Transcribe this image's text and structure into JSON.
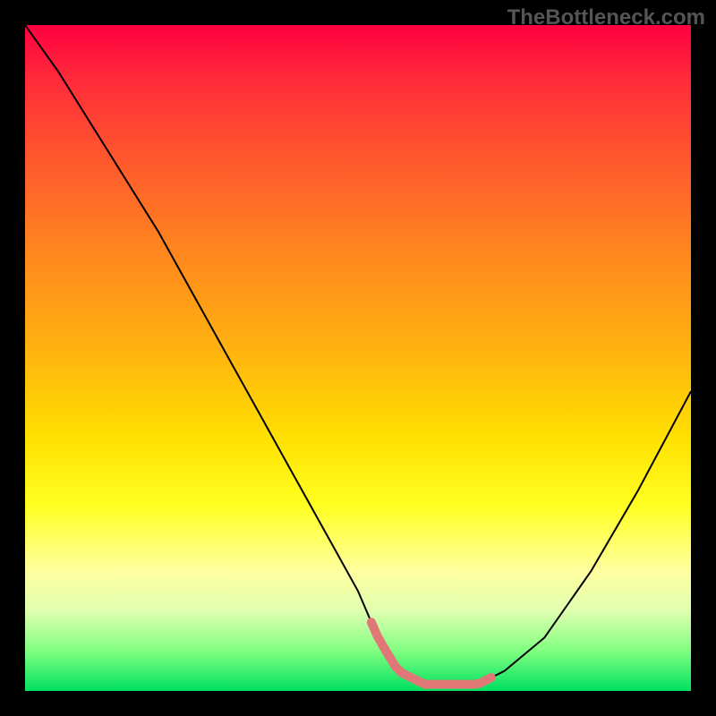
{
  "watermark": "TheBottleneck.com",
  "chart_data": {
    "type": "line",
    "title": "",
    "xlabel": "",
    "ylabel": "",
    "xlim": [
      0,
      100
    ],
    "ylim": [
      0,
      100
    ],
    "series": [
      {
        "name": "bottleneck-curve",
        "x": [
          0,
          5,
          10,
          15,
          20,
          25,
          30,
          35,
          40,
          45,
          50,
          53,
          56,
          60,
          65,
          68,
          72,
          78,
          85,
          92,
          100
        ],
        "values": [
          100,
          93,
          85,
          77,
          69,
          60,
          51,
          42,
          33,
          24,
          15,
          8,
          3,
          1,
          1,
          1,
          3,
          8,
          18,
          30,
          45
        ]
      }
    ],
    "annotations": [
      {
        "name": "pink-flat-segment",
        "x_range": [
          52,
          70
        ],
        "y": 2,
        "color": "#e07878"
      }
    ]
  }
}
